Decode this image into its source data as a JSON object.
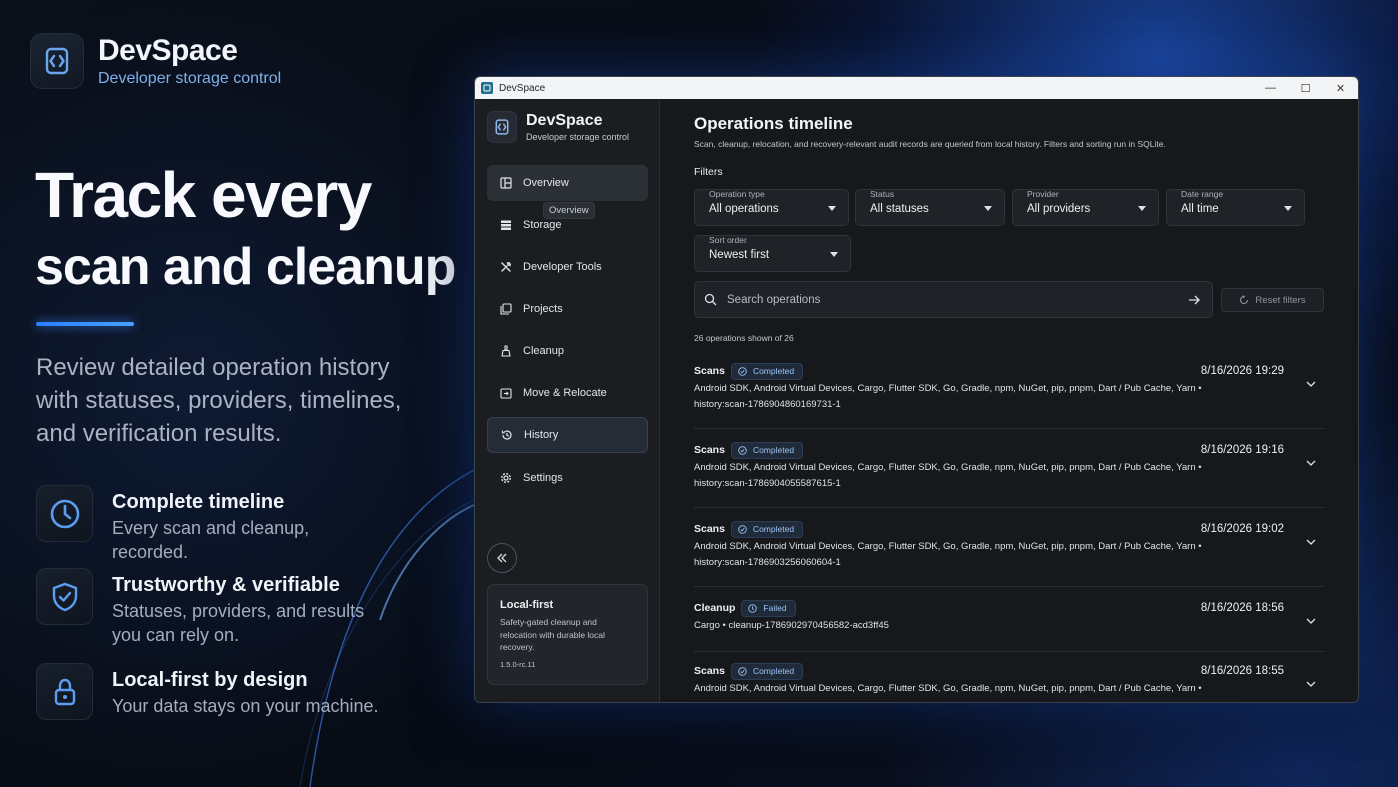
{
  "brand": {
    "name": "DevSpace",
    "subtitle": "Developer storage control"
  },
  "hero": {
    "line1": "Track every",
    "line2": "scan and cleanup",
    "lede": "Review detailed operation history with statuses, providers, timelines, and verification results."
  },
  "features": [
    {
      "icon": "clock-icon",
      "title": "Complete timeline",
      "desc": "Every scan and cleanup, recorded."
    },
    {
      "icon": "shield-check-icon",
      "title": "Trustworthy & verifiable",
      "desc": "Statuses, providers, and results you can rely on."
    },
    {
      "icon": "lock-icon",
      "title": "Local-first by design",
      "desc": "Your data stays on your machine."
    }
  ],
  "window": {
    "title": "DevSpace",
    "controls": {
      "minimize": "—",
      "maximize": "☐",
      "close": "✕"
    }
  },
  "sidebar": {
    "name": "DevSpace",
    "subtitle": "Developer storage control",
    "items": [
      {
        "label": "Overview",
        "icon": "overview-icon",
        "state": "hover"
      },
      {
        "label": "Storage",
        "icon": "storage-icon",
        "state": ""
      },
      {
        "label": "Developer Tools",
        "icon": "tools-icon",
        "state": ""
      },
      {
        "label": "Projects",
        "icon": "projects-icon",
        "state": ""
      },
      {
        "label": "Cleanup",
        "icon": "cleanup-icon",
        "state": ""
      },
      {
        "label": "Move & Relocate",
        "icon": "move-icon",
        "state": ""
      },
      {
        "label": "History",
        "icon": "history-icon",
        "state": "active"
      },
      {
        "label": "Settings",
        "icon": "gear-icon",
        "state": ""
      }
    ],
    "tooltip": "Overview",
    "card": {
      "title": "Local-first",
      "desc": "Safety-gated cleanup and relocation with durable local recovery.",
      "version": "1.5.0-rc.11"
    }
  },
  "main": {
    "title": "Operations timeline",
    "description": "Scan, cleanup, relocation, and recovery-relevant audit records are queried from local history. Filters and sorting run in SQLite.",
    "filters_label": "Filters",
    "filters": [
      {
        "caption": "Operation type",
        "value": "All operations"
      },
      {
        "caption": "Status",
        "value": "All statuses"
      },
      {
        "caption": "Provider",
        "value": "All providers"
      },
      {
        "caption": "Date range",
        "value": "All time"
      },
      {
        "caption": "Sort order",
        "value": "Newest first"
      }
    ],
    "search": {
      "placeholder": "Search operations",
      "value": ""
    },
    "reset_label": "Reset filters",
    "count_text": "26 operations shown of 26",
    "operations": [
      {
        "type": "Scans",
        "status": "Completed",
        "date": "8/16/2026 19:29",
        "providers": "Android SDK, Android Virtual Devices, Cargo, Flutter SDK, Go, Gradle, npm, NuGet, pip, pnpm, Dart / Pub Cache, Yarn •",
        "id": "history:scan-1786904860169731-1"
      },
      {
        "type": "Scans",
        "status": "Completed",
        "date": "8/16/2026 19:16",
        "providers": "Android SDK, Android Virtual Devices, Cargo, Flutter SDK, Go, Gradle, npm, NuGet, pip, pnpm, Dart / Pub Cache, Yarn •",
        "id": "history:scan-1786904055587615-1"
      },
      {
        "type": "Scans",
        "status": "Completed",
        "date": "8/16/2026 19:02",
        "providers": "Android SDK, Android Virtual Devices, Cargo, Flutter SDK, Go, Gradle, npm, NuGet, pip, pnpm, Dart / Pub Cache, Yarn •",
        "id": "history:scan-1786903256060604-1"
      },
      {
        "type": "Cleanup",
        "status": "Failed",
        "date": "8/16/2026 18:56",
        "providers": "Cargo • cleanup-1786902970456582-acd3ff45",
        "id": ""
      },
      {
        "type": "Scans",
        "status": "Completed",
        "date": "8/16/2026 18:55",
        "providers": "Android SDK, Android Virtual Devices, Cargo, Flutter SDK, Go, Gradle, npm, NuGet, pip, pnpm, Dart / Pub Cache, Yarn •",
        "id": ""
      }
    ]
  },
  "colors": {
    "accent": "#2c7dff",
    "badge_text": "#9ec3f2"
  }
}
